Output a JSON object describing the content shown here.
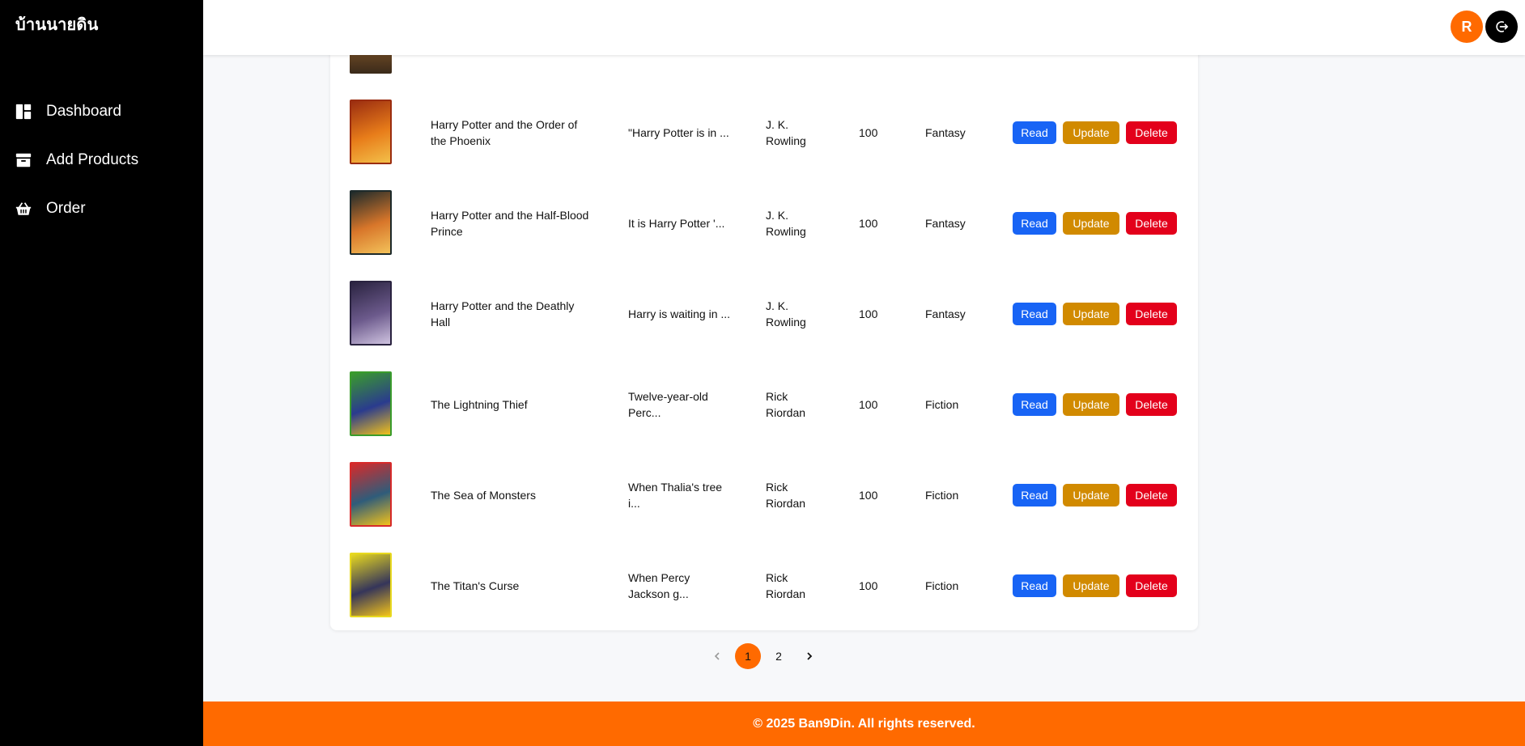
{
  "sidebar": {
    "brand": "บ้านนายดิน",
    "items": [
      {
        "label": "Dashboard",
        "icon": "dashboard-icon"
      },
      {
        "label": "Add Products",
        "icon": "archive-box-icon"
      },
      {
        "label": "Order",
        "icon": "basket-icon"
      }
    ]
  },
  "header": {
    "avatar_initial": "R"
  },
  "actions": {
    "read": "Read",
    "update": "Update",
    "delete": "Delete"
  },
  "products": [
    {
      "title": "Harry Potter and the Order of the Phoenix",
      "description": "\"Harry Potter is in ...",
      "author": "J. K. Rowling",
      "stock": "100",
      "category": "Fantasy",
      "cover": [
        "#9b2d10",
        "#e87d1a",
        "#f3c04a"
      ]
    },
    {
      "title": "Harry Potter and the Half-Blood Prince",
      "description": "It is Harry Potter '...",
      "author": "J. K. Rowling",
      "stock": "100",
      "category": "Fantasy",
      "cover": [
        "#1d2a2b",
        "#d8762a",
        "#f3c25a"
      ]
    },
    {
      "title": "Harry Potter and the Deathly Hall",
      "description": "Harry is waiting in ...",
      "author": "J. K. Rowling",
      "stock": "100",
      "category": "Fantasy",
      "cover": [
        "#2a2340",
        "#6c5a8c",
        "#cfc3e0"
      ]
    },
    {
      "title": "The Lightning Thief",
      "description": "Twelve-year-old Perc...",
      "author": "Rick Riordan",
      "stock": "100",
      "category": "Fiction",
      "cover": [
        "#3a9c2c",
        "#2a3b8e",
        "#f2c21a"
      ]
    },
    {
      "title": "The Sea of Monsters",
      "description": "When Thalia's tree i...",
      "author": "Rick Riordan",
      "stock": "100",
      "category": "Fiction",
      "cover": [
        "#d72a2a",
        "#2f5c7a",
        "#f2c21a"
      ]
    },
    {
      "title": "The Titan's Curse",
      "description": "When Percy Jackson g...",
      "author": "Rick Riordan",
      "stock": "100",
      "category": "Fiction",
      "cover": [
        "#e8d91f",
        "#35355a",
        "#f2c21a"
      ]
    }
  ],
  "pagination": {
    "pages": [
      "1",
      "2"
    ],
    "current": "1"
  },
  "footer": {
    "text": "© 2025 Ban9Din. All rights reserved."
  },
  "colors": {
    "accent": "#ff6a00",
    "read": "#1864f5",
    "update": "#d18a00",
    "delete": "#e3001b"
  }
}
